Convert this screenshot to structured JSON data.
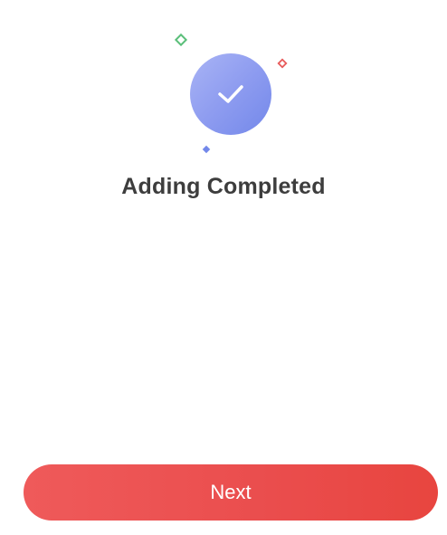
{
  "status": {
    "title": "Adding Completed",
    "icon": "checkmark-icon"
  },
  "actions": {
    "next_label": "Next"
  },
  "colors": {
    "badge_gradient_start": "#a9b4f5",
    "badge_gradient_end": "#7388ea",
    "sparkle_green": "#5bbf7a",
    "sparkle_red": "#e85a5a",
    "sparkle_blue": "#7388ea",
    "button_gradient_start": "#ef5a5a",
    "button_gradient_end": "#e8453f",
    "title_color": "#3d3d3d"
  }
}
